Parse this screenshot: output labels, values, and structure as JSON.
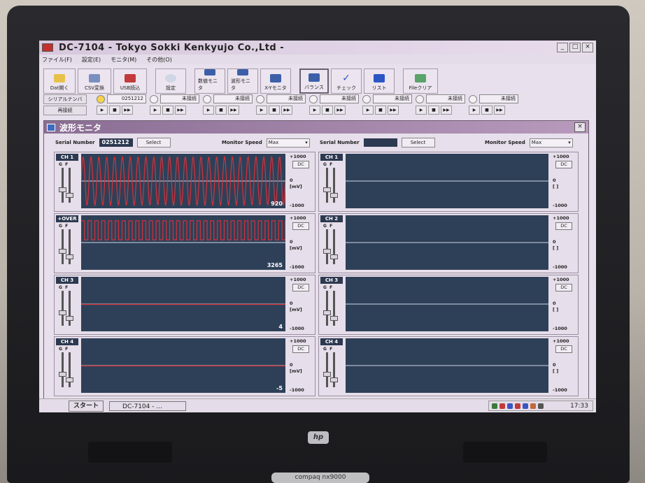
{
  "window": {
    "title": "DC-7104 - Tokyo Sokki Kenkyujo Co.,Ltd -",
    "min": "_",
    "max": "□",
    "close": "×"
  },
  "menu": [
    "ファイル(F)",
    "設定(E)",
    "モニタ(M)",
    "その他(O)"
  ],
  "toolbar": [
    {
      "label": "Dat開く",
      "icon": "folder-icon"
    },
    {
      "label": "CSV変換",
      "icon": "convert-icon"
    },
    {
      "label": "USB読込",
      "icon": "usb-icon"
    },
    {
      "label": "設定",
      "icon": "settings-icon"
    },
    {
      "label": "数値モニタ",
      "icon": "numeric-monitor-icon"
    },
    {
      "label": "波形モニタ",
      "icon": "wave-monitor-icon"
    },
    {
      "label": "X-Yモニタ",
      "icon": "xy-monitor-icon"
    },
    {
      "label": "バランス",
      "icon": "balance-icon"
    },
    {
      "label": "チェック",
      "icon": "check-icon"
    },
    {
      "label": "リスト",
      "icon": "list-icon"
    },
    {
      "label": "Fileクリア",
      "icon": "file-clear-icon"
    }
  ],
  "control": {
    "serial_label": "シリアルナンバ",
    "reconnect_label": "再接続",
    "units": [
      {
        "value": "0251212",
        "connected": true
      },
      {
        "value": "未接続",
        "connected": false
      },
      {
        "value": "未接続",
        "connected": false
      },
      {
        "value": "未接続",
        "connected": false
      },
      {
        "value": "未接続",
        "connected": false
      },
      {
        "value": "未接続",
        "connected": false
      },
      {
        "value": "未接続",
        "connected": false
      },
      {
        "value": "未接続",
        "connected": false
      }
    ],
    "play_buttons": [
      "▶",
      "■",
      "▶▶"
    ]
  },
  "monitor": {
    "title": "波形モニタ",
    "close": "×",
    "left": {
      "serial_label": "Serial Number",
      "serial_value": "0251212",
      "select_label": "Select",
      "speed_label": "Monitor Speed",
      "speed_value": "Max",
      "channels": [
        {
          "name": "CH 1",
          "value": "920",
          "wave": "sine",
          "active": true
        },
        {
          "name": "+OVER",
          "value": "3265",
          "wave": "square",
          "active": true
        },
        {
          "name": "CH 3",
          "value": "4",
          "wave": "flat",
          "active": true
        },
        {
          "name": "CH 4",
          "value": "-5",
          "wave": "flat",
          "active": true
        }
      ]
    },
    "right": {
      "serial_label": "Serial Number",
      "serial_value": "",
      "select_label": "Select",
      "speed_label": "Monitor Speed",
      "speed_value": "Max",
      "channels": [
        {
          "name": "CH 1",
          "value": "",
          "wave": "none",
          "active": false
        },
        {
          "name": "CH 2",
          "value": "",
          "wave": "none",
          "active": false
        },
        {
          "name": "CH 3",
          "value": "",
          "wave": "none",
          "active": false
        },
        {
          "name": "CH 4",
          "value": "",
          "wave": "none",
          "active": false
        }
      ]
    },
    "scale": {
      "max": "+1000",
      "zero": "0",
      "unit": "[mV]",
      "min": "-1000",
      "dc": "DC",
      "g": "G",
      "f": "F",
      "empty_unit": "[ ]"
    }
  },
  "taskbar": {
    "start": "スタート",
    "task": "DC-7104 - ...",
    "time": "17:33"
  },
  "laptop": {
    "logo": "hp",
    "model": "compaq nx9000"
  }
}
